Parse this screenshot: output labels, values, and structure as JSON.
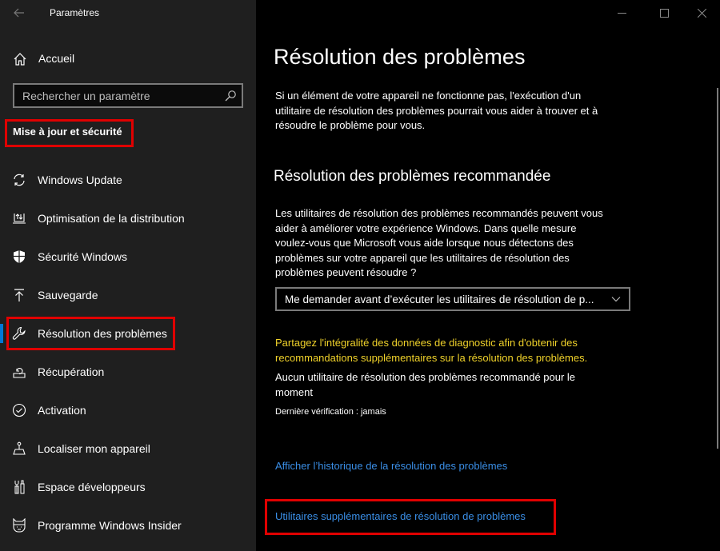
{
  "window": {
    "title": "Paramètres",
    "back_icon": "back-arrow-icon",
    "controls": {
      "minimize": "minimize-icon",
      "maximize": "maximize-icon",
      "close": "close-icon"
    }
  },
  "sidebar": {
    "home": {
      "label": "Accueil",
      "icon": "home-icon"
    },
    "search": {
      "placeholder": "Rechercher un paramètre",
      "value": "",
      "icon": "search-icon"
    },
    "section_title": "Mise à jour et sécurité",
    "items": [
      {
        "label": "Windows Update",
        "icon": "sync-icon",
        "active": false
      },
      {
        "label": "Optimisation de la distribution",
        "icon": "delivery-optimization-icon",
        "active": false
      },
      {
        "label": "Sécurité Windows",
        "icon": "shield-icon",
        "active": false
      },
      {
        "label": "Sauvegarde",
        "icon": "backup-upload-icon",
        "active": false
      },
      {
        "label": "Résolution des problèmes",
        "icon": "wrench-icon",
        "active": true
      },
      {
        "label": "Récupération",
        "icon": "recovery-icon",
        "active": false
      },
      {
        "label": "Activation",
        "icon": "check-circle-icon",
        "active": false
      },
      {
        "label": "Localiser mon appareil",
        "icon": "find-device-icon",
        "active": false
      },
      {
        "label": "Espace développeurs",
        "icon": "developer-tools-icon",
        "active": false
      },
      {
        "label": "Programme Windows Insider",
        "icon": "insider-cat-icon",
        "active": false
      }
    ]
  },
  "main": {
    "title": "Résolution des problèmes",
    "intro_lines": [
      "Si un élément de votre appareil ne fonctionne pas, l'exécution d'un",
      "utilitaire de résolution des problèmes pourrait vous aider à trouver et à",
      "résoudre le problème pour vous."
    ],
    "recommended": {
      "heading": "Résolution des problèmes recommandée",
      "description_lines": [
        "Les utilitaires de résolution des problèmes recommandés peuvent vous",
        "aider à améliorer votre expérience Windows. Dans quelle mesure",
        "voulez-vous que Microsoft vous aide lorsque nous détectons des",
        "problèmes sur votre appareil que les utilitaires de résolution des",
        "problèmes peuvent résoudre ?"
      ],
      "dropdown_value": "Me demander avant d’exécuter les utilitaires de résolution de p...",
      "diagnostic_link_lines": [
        "Partagez l'intégralité des données de diagnostic afin d'obtenir des",
        "recommandations supplémentaires sur la résolution des problèmes."
      ],
      "status_lines": [
        "Aucun utilitaire de résolution des problèmes recommandé pour le",
        "moment"
      ],
      "last_check": "Dernière vérification : jamais"
    },
    "links": {
      "history": "Afficher l’historique de la résolution des problèmes",
      "additional": "Utilitaires supplémentaires de résolution de problèmes"
    }
  },
  "colors": {
    "accent": "#0078d7",
    "link": "#3a8ee6",
    "warning_link": "#f0d22a",
    "highlight_box": "#e00000",
    "sidebar_bg": "#1f1f1f",
    "main_bg": "#000000"
  }
}
